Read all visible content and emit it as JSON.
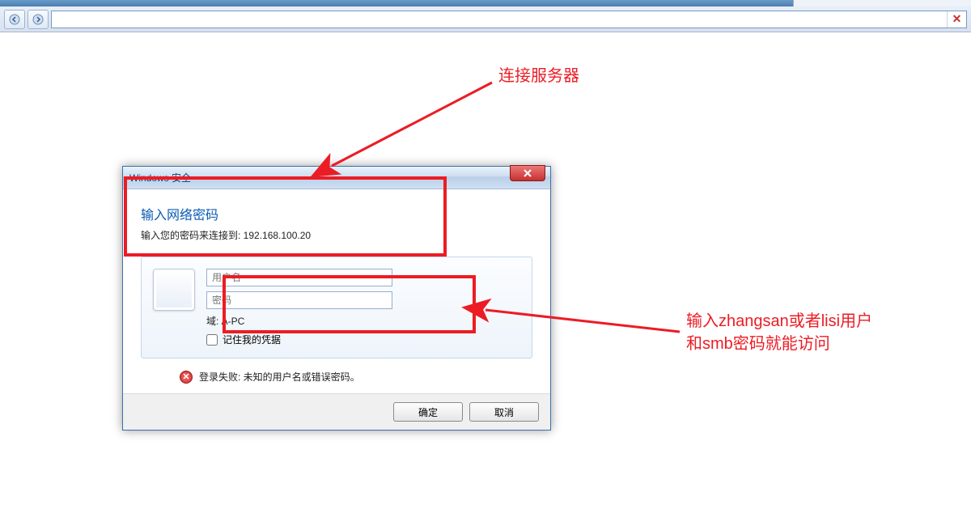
{
  "titlebar": {
    "app_hint": ""
  },
  "navbar": {
    "address": ""
  },
  "dialog": {
    "window_title": "Windows 安全",
    "heading": "输入网络密码",
    "subheading": "输入您的密码来连接到: 192.168.100.20",
    "username_placeholder": "用户名",
    "password_placeholder": "密码",
    "domain_label": "域: A-PC",
    "remember_label": "记住我的凭据",
    "error_text": "登录失败: 未知的用户名或错误密码。",
    "ok_label": "确定",
    "cancel_label": "取消"
  },
  "annotations": {
    "top": "连接服务器",
    "right_line1": "输入zhangsan或者lisi用户",
    "right_line2": "和smb密码就能访问"
  }
}
